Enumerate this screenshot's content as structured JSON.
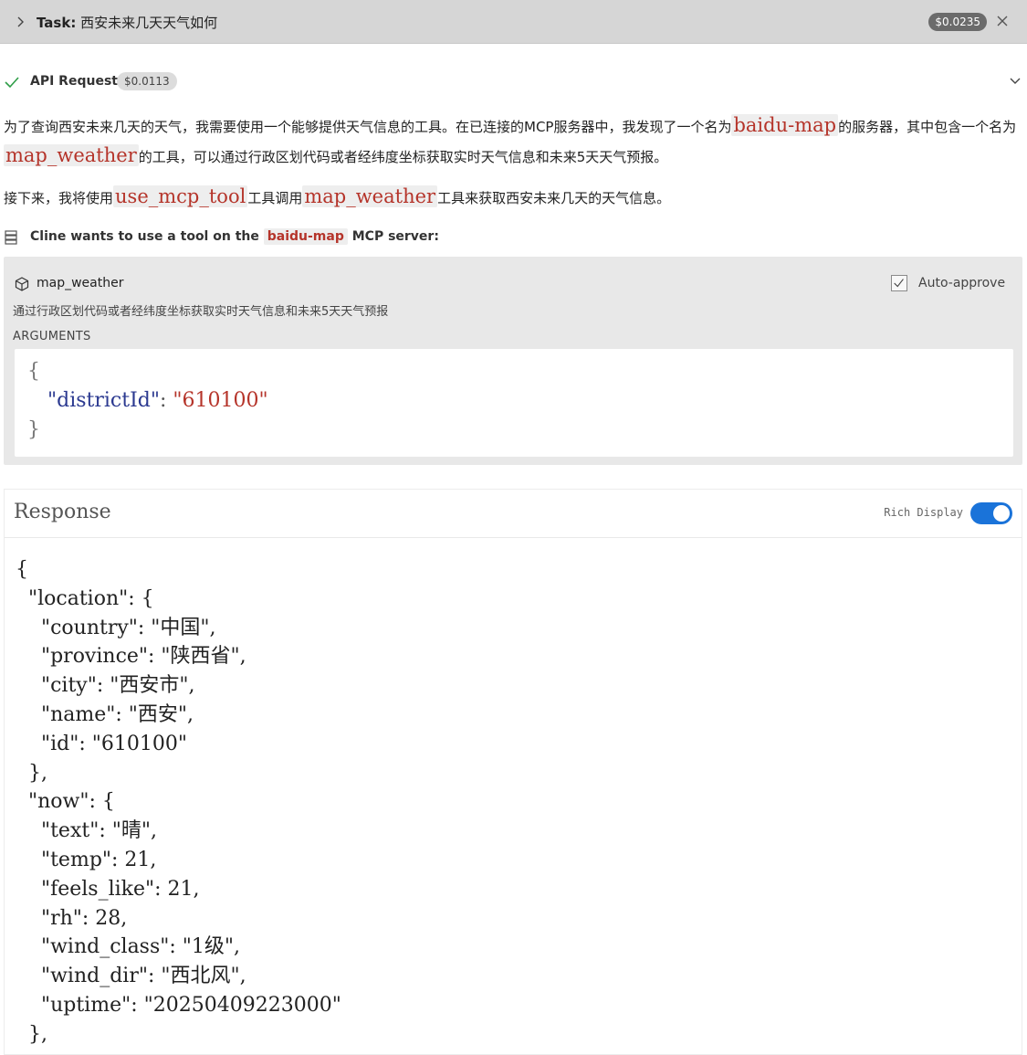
{
  "task": {
    "prefix": "Task:",
    "title": "西安未来几天天气如何",
    "cost": "$0.0235"
  },
  "api_request": {
    "label": "API Request",
    "cost": "$0.0113"
  },
  "message": {
    "p1_a": "为了查询西安未来几天的天气，我需要使用一个能够提供天气信息的工具。在已连接的MCP服务器中，我发现了一个名为",
    "p1_code1": "baidu-map",
    "p1_b": "的服务器，其中包含一个名为",
    "p1_code2": "map_weather",
    "p1_c": "的工具，可以通过行政区划代码或者经纬度坐标获取实时天气信息和未来5天天气预报。",
    "p2_a": "接下来，我将使用",
    "p2_code1": "use_mcp_tool",
    "p2_b": "工具调用",
    "p2_code2": "map_weather",
    "p2_c": "工具来获取西安未来几天的天气信息。"
  },
  "mcp": {
    "prefix": "Cline wants to use a tool on the",
    "server": "baidu-map",
    "suffix": "MCP server:"
  },
  "tool": {
    "name": "map_weather",
    "auto_approve_label": "Auto-approve",
    "auto_approve_checked": true,
    "description": "通过行政区划代码或者经纬度坐标获取实时天气信息和未来5天天气预报",
    "arguments_label": "ARGUMENTS",
    "args_open": "{",
    "args_key": "\"districtId\"",
    "args_sep": ": ",
    "args_value": "\"610100\"",
    "args_close": "}"
  },
  "response": {
    "title": "Response",
    "rich_display_label": "Rich Display",
    "rich_display_on": true,
    "body": "{\n  \"location\": {\n    \"country\": \"中国\",\n    \"province\": \"陕西省\",\n    \"city\": \"西安市\",\n    \"name\": \"西安\",\n    \"id\": \"610100\"\n  },\n  \"now\": {\n    \"text\": \"晴\",\n    \"temp\": 21,\n    \"feels_like\": 21,\n    \"rh\": 28,\n    \"wind_class\": \"1级\",\n    \"wind_dir\": \"西北风\",\n    \"uptime\": \"20250409223000\"\n  },"
  },
  "colors": {
    "accent_blue": "#1a73d9",
    "code_red": "#b5342a",
    "json_key_blue": "#2b3990",
    "success_green": "#2e9d47"
  },
  "icons": {
    "task_expand": "chevron-right-icon",
    "close": "close-icon",
    "status": "check-icon",
    "collapse": "chevron-down-icon",
    "server": "server-icon",
    "tool": "cube-icon"
  }
}
